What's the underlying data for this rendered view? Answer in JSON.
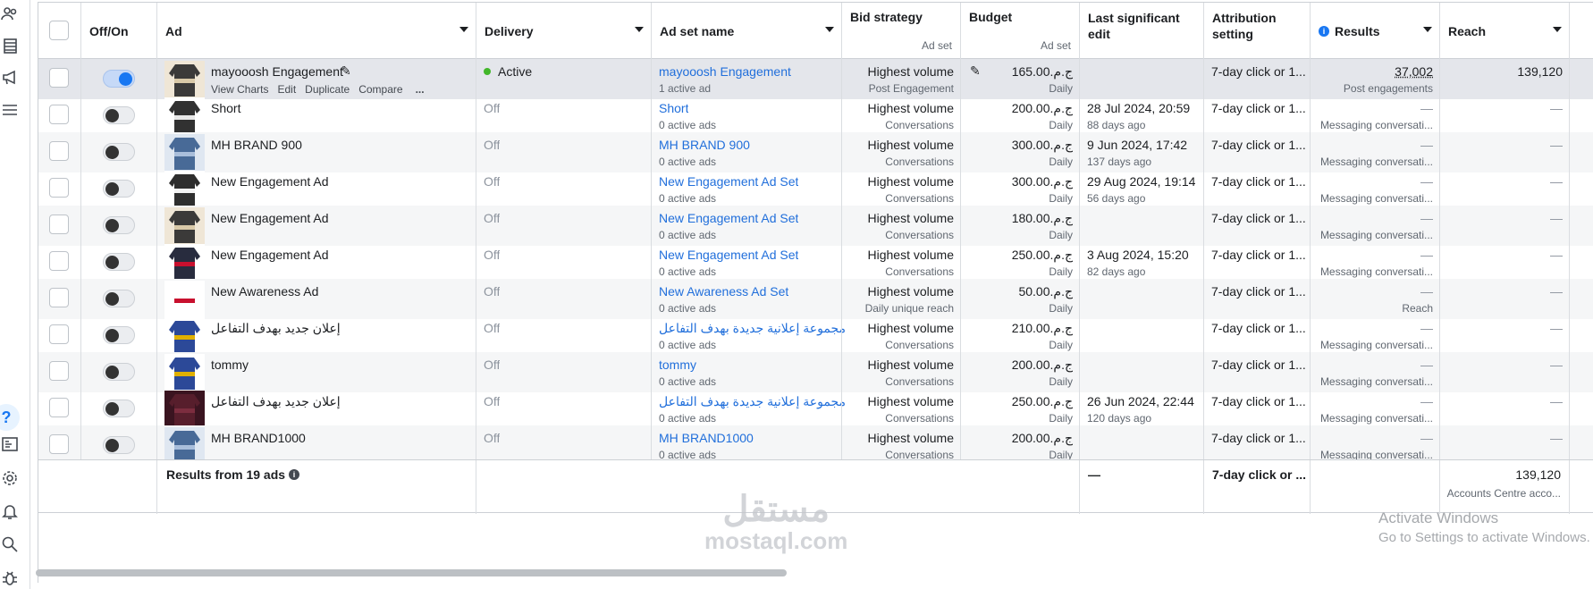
{
  "columns": {
    "offon": "Off/On",
    "ad": "Ad",
    "delivery": "Delivery",
    "adset_name": "Ad set name",
    "bid_strategy": "Bid strategy",
    "bid_strategy_sub": "Ad set",
    "budget": "Budget",
    "budget_sub": "Ad set",
    "last_edit": "Last significant edit",
    "attribution": "Attribution setting",
    "results": "Results",
    "reach": "Reach"
  },
  "row_actions": {
    "view_charts": "View Charts",
    "edit": "Edit",
    "duplicate": "Duplicate",
    "compare": "Compare",
    "more": "..."
  },
  "rows": [
    {
      "on": true,
      "ad": "mayooosh Engagement",
      "delivery": "Active",
      "adset": "mayooosh Engagement",
      "adset_sub": "1 active ad",
      "bid": "Highest volume",
      "bid_sub": "Post Engagement",
      "budget": "ج.م.165.00",
      "budget_sub": "Daily",
      "edit": "",
      "edit_sub": "",
      "attribution": "7-day click or 1...",
      "result": "37,002",
      "result_sub": "Post engagements",
      "reach": "139,120"
    },
    {
      "on": false,
      "ad": "Short",
      "delivery": "Off",
      "adset": "Short",
      "adset_sub": "0 active ads",
      "bid": "Highest volume",
      "bid_sub": "Conversations",
      "budget": "ج.م.200.00",
      "budget_sub": "Daily",
      "edit": "28 Jul 2024, 20:59",
      "edit_sub": "88 days ago",
      "attribution": "7-day click or 1...",
      "result": "—",
      "result_sub": "Messaging conversati...",
      "reach": "—"
    },
    {
      "on": false,
      "ad": "MH BRAND 900",
      "delivery": "Off",
      "adset": "MH BRAND 900",
      "adset_sub": "0 active ads",
      "bid": "Highest volume",
      "bid_sub": "Conversations",
      "budget": "ج.م.300.00",
      "budget_sub": "Daily",
      "edit": "9 Jun 2024, 17:42",
      "edit_sub": "137 days ago",
      "attribution": "7-day click or 1...",
      "result": "—",
      "result_sub": "Messaging conversati...",
      "reach": "—"
    },
    {
      "on": false,
      "ad": "New Engagement Ad",
      "delivery": "Off",
      "adset": "New Engagement Ad Set",
      "adset_sub": "0 active ads",
      "bid": "Highest volume",
      "bid_sub": "Conversations",
      "budget": "ج.م.300.00",
      "budget_sub": "Daily",
      "edit": "29 Aug 2024, 19:14",
      "edit_sub": "56 days ago",
      "attribution": "7-day click or 1...",
      "result": "—",
      "result_sub": "Messaging conversati...",
      "reach": "—"
    },
    {
      "on": false,
      "ad": "New Engagement Ad",
      "delivery": "Off",
      "adset": "New Engagement Ad Set",
      "adset_sub": "0 active ads",
      "bid": "Highest volume",
      "bid_sub": "Conversations",
      "budget": "ج.م.180.00",
      "budget_sub": "Daily",
      "edit": "",
      "edit_sub": "",
      "attribution": "7-day click or 1...",
      "result": "—",
      "result_sub": "Messaging conversati...",
      "reach": "—"
    },
    {
      "on": false,
      "ad": "New Engagement Ad",
      "delivery": "Off",
      "adset": "New Engagement Ad Set",
      "adset_sub": "0 active ads",
      "bid": "Highest volume",
      "bid_sub": "Conversations",
      "budget": "ج.م.250.00",
      "budget_sub": "Daily",
      "edit": "3 Aug 2024, 15:20",
      "edit_sub": "82 days ago",
      "attribution": "7-day click or 1...",
      "result": "—",
      "result_sub": "Messaging conversati...",
      "reach": "—"
    },
    {
      "on": false,
      "ad": "New Awareness Ad",
      "delivery": "Off",
      "adset": "New Awareness Ad Set",
      "adset_sub": "0 active ads",
      "bid": "Highest volume",
      "bid_sub": "Daily unique reach",
      "budget": "ج.م.50.00",
      "budget_sub": "Daily",
      "edit": "",
      "edit_sub": "",
      "attribution": "7-day click or 1...",
      "result": "—",
      "result_sub": "Reach",
      "reach": "—"
    },
    {
      "on": false,
      "ad": "إعلان جديد بهدف التفاعل",
      "delivery": "Off",
      "adset": "مجموعة إعلانية جديدة بهدف التفاعل",
      "adset_sub": "0 active ads",
      "bid": "Highest volume",
      "bid_sub": "Conversations",
      "budget": "ج.م.210.00",
      "budget_sub": "Daily",
      "edit": "",
      "edit_sub": "",
      "attribution": "7-day click or 1...",
      "result": "—",
      "result_sub": "Messaging conversati...",
      "reach": "—"
    },
    {
      "on": false,
      "ad": "tommy",
      "delivery": "Off",
      "adset": "tommy",
      "adset_sub": "0 active ads",
      "bid": "Highest volume",
      "bid_sub": "Conversations",
      "budget": "ج.م.200.00",
      "budget_sub": "Daily",
      "edit": "",
      "edit_sub": "",
      "attribution": "7-day click or 1...",
      "result": "—",
      "result_sub": "Messaging conversati...",
      "reach": "—"
    },
    {
      "on": false,
      "ad": "إعلان جديد بهدف التفاعل",
      "delivery": "Off",
      "adset": "مجموعة إعلانية جديدة بهدف التفاعل",
      "adset_sub": "0 active ads",
      "bid": "Highest volume",
      "bid_sub": "Conversations",
      "budget": "ج.م.250.00",
      "budget_sub": "Daily",
      "edit": "26 Jun 2024, 22:44",
      "edit_sub": "120 days ago",
      "attribution": "7-day click or 1...",
      "result": "—",
      "result_sub": "Messaging conversati...",
      "reach": "—"
    },
    {
      "on": false,
      "ad": "MH BRAND1000",
      "delivery": "Off",
      "adset": "MH BRAND1000",
      "adset_sub": "0 active ads",
      "bid": "Highest volume",
      "bid_sub": "Conversations",
      "budget": "ج.م.200.00",
      "budget_sub": "Daily",
      "edit": "",
      "edit_sub": "",
      "attribution": "7-day click or 1...",
      "result": "—",
      "result_sub": "Messaging conversati...",
      "reach": "—"
    }
  ],
  "footer": {
    "label": "Results from 19 ads",
    "last_edit": "—",
    "attribution": "7-day click or ...",
    "reach": "139,120",
    "reach_sub": "Accounts Centre acco..."
  },
  "watermark": {
    "arabic": "مستقل",
    "latin": "mostaql.com"
  },
  "os_notice": {
    "title": "Activate Windows",
    "subtitle": "Go to Settings to activate Windows."
  },
  "colors": {
    "accent": "#1877f2",
    "active": "#42b72a",
    "link": "#216fdb"
  }
}
